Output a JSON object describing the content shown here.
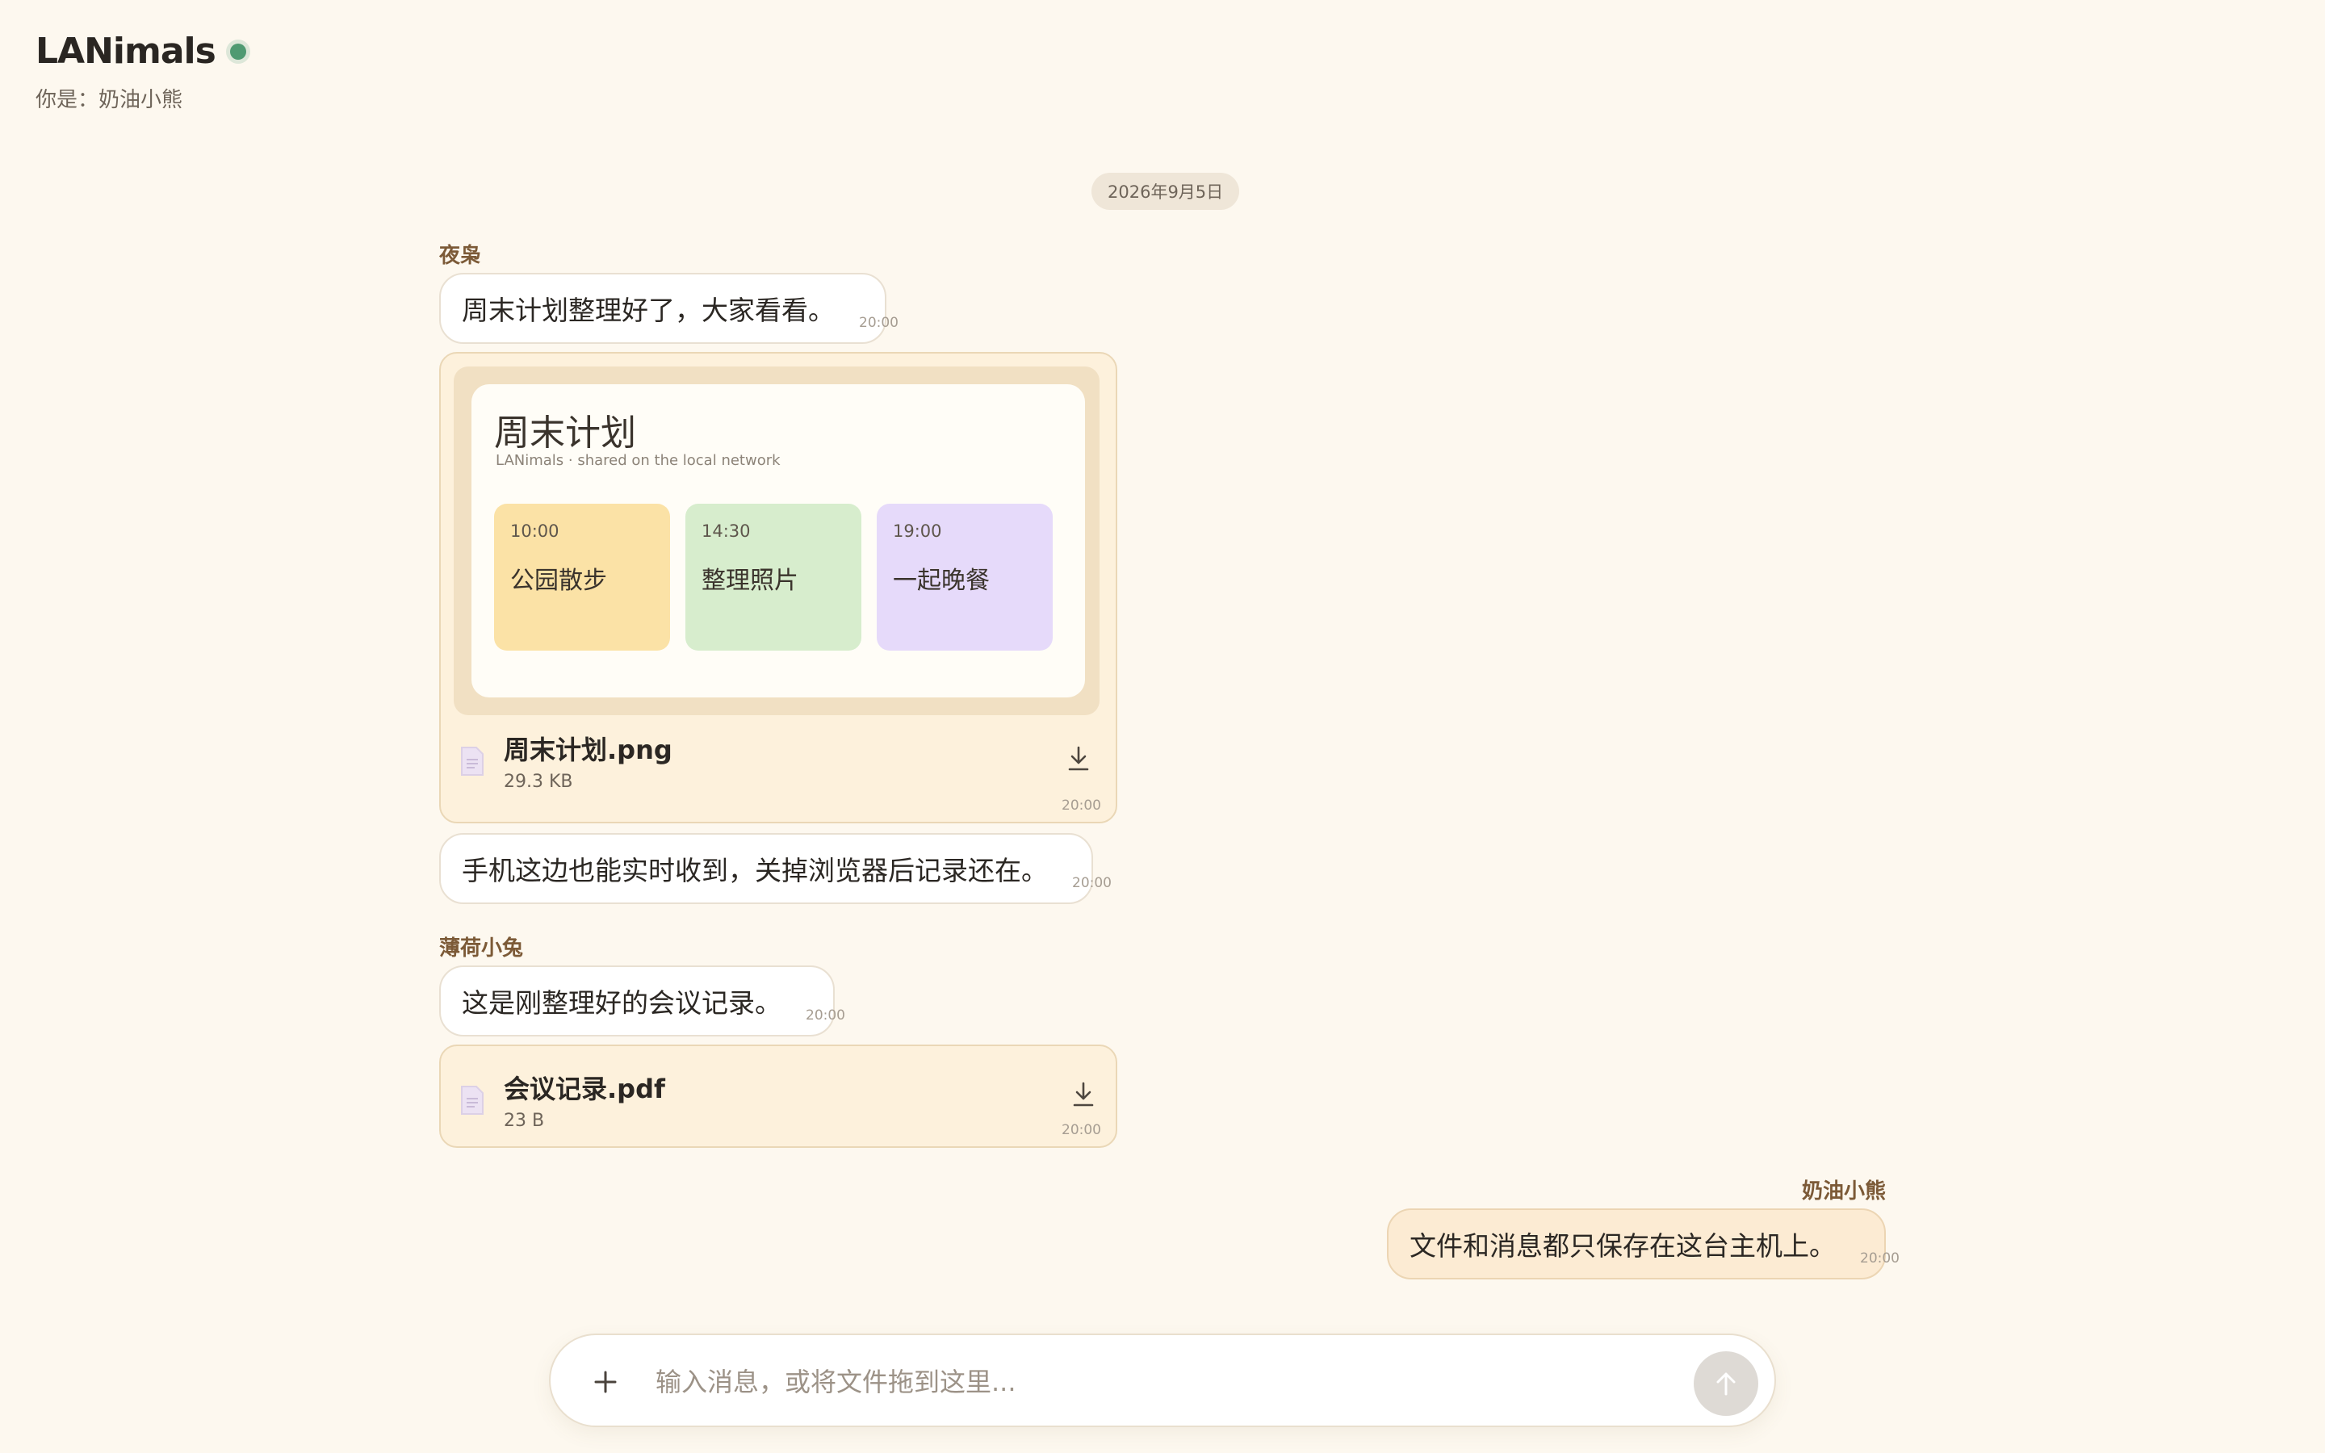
{
  "header": {
    "app_title": "LANimals",
    "identity": "你是：奶油小熊",
    "online_color": "#4f9a72"
  },
  "date_divider": "2026年9月5日",
  "messages": [
    {
      "sender": "夜枭",
      "text": "周末计划整理好了，大家看看。",
      "time": "20:00"
    },
    {
      "file": {
        "preview": {
          "title": "周末计划",
          "subtitle": "LANimals · shared on the local network",
          "cards": [
            {
              "time": "10:00",
              "label": "公园散步",
              "color": "#fbe2a6"
            },
            {
              "time": "14:30",
              "label": "整理照片",
              "color": "#d7edcd"
            },
            {
              "time": "19:00",
              "label": "一起晚餐",
              "color": "#e6dafa"
            }
          ]
        },
        "name": "周末计划.png",
        "size": "29.3 KB",
        "time": "20:00",
        "icon": "document-icon",
        "action_icon": "download-icon"
      }
    },
    {
      "text": "手机这边也能实时收到，关掉浏览器后记录还在。",
      "time": "20:00"
    },
    {
      "sender": "薄荷小兔",
      "text": "这是刚整理好的会议记录。",
      "time": "20:00"
    },
    {
      "file": {
        "name": "会议记录.pdf",
        "size": "23 B",
        "time": "20:00",
        "icon": "document-icon",
        "action_icon": "download-icon"
      }
    },
    {
      "sender": "奶油小熊",
      "text": "文件和消息都只保存在这台主机上。",
      "time": "20:00",
      "mine": true
    }
  ],
  "composer": {
    "attach_icon": "plus-icon",
    "placeholder": "输入消息，或将文件拖到这里...",
    "value": "",
    "send_icon": "arrow-up-icon"
  },
  "colors": {
    "background": "#fdf8ef",
    "sender_name": "#7c5a37",
    "my_bubble": "#fcebd3",
    "file_card": "#fdf1dc"
  }
}
